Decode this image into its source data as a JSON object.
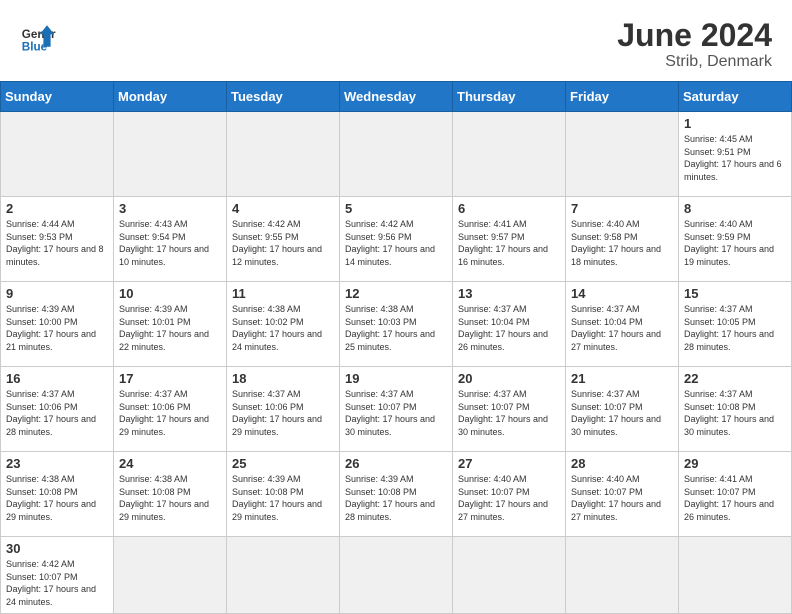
{
  "header": {
    "logo_general": "General",
    "logo_blue": "Blue",
    "month_year": "June 2024",
    "location": "Strib, Denmark"
  },
  "days_of_week": [
    "Sunday",
    "Monday",
    "Tuesday",
    "Wednesday",
    "Thursday",
    "Friday",
    "Saturday"
  ],
  "weeks": [
    [
      {
        "day": "",
        "empty": true
      },
      {
        "day": "",
        "empty": true
      },
      {
        "day": "",
        "empty": true
      },
      {
        "day": "",
        "empty": true
      },
      {
        "day": "",
        "empty": true
      },
      {
        "day": "",
        "empty": true
      },
      {
        "day": "1",
        "sunrise": "Sunrise: 4:45 AM",
        "sunset": "Sunset: 9:51 PM",
        "daylight": "Daylight: 17 hours and 6 minutes."
      }
    ],
    [
      {
        "day": "2",
        "sunrise": "Sunrise: 4:44 AM",
        "sunset": "Sunset: 9:53 PM",
        "daylight": "Daylight: 17 hours and 8 minutes."
      },
      {
        "day": "3",
        "sunrise": "Sunrise: 4:43 AM",
        "sunset": "Sunset: 9:54 PM",
        "daylight": "Daylight: 17 hours and 10 minutes."
      },
      {
        "day": "4",
        "sunrise": "Sunrise: 4:42 AM",
        "sunset": "Sunset: 9:55 PM",
        "daylight": "Daylight: 17 hours and 12 minutes."
      },
      {
        "day": "5",
        "sunrise": "Sunrise: 4:42 AM",
        "sunset": "Sunset: 9:56 PM",
        "daylight": "Daylight: 17 hours and 14 minutes."
      },
      {
        "day": "6",
        "sunrise": "Sunrise: 4:41 AM",
        "sunset": "Sunset: 9:57 PM",
        "daylight": "Daylight: 17 hours and 16 minutes."
      },
      {
        "day": "7",
        "sunrise": "Sunrise: 4:40 AM",
        "sunset": "Sunset: 9:58 PM",
        "daylight": "Daylight: 17 hours and 18 minutes."
      },
      {
        "day": "8",
        "sunrise": "Sunrise: 4:40 AM",
        "sunset": "Sunset: 9:59 PM",
        "daylight": "Daylight: 17 hours and 19 minutes."
      }
    ],
    [
      {
        "day": "9",
        "sunrise": "Sunrise: 4:39 AM",
        "sunset": "Sunset: 10:00 PM",
        "daylight": "Daylight: 17 hours and 21 minutes."
      },
      {
        "day": "10",
        "sunrise": "Sunrise: 4:39 AM",
        "sunset": "Sunset: 10:01 PM",
        "daylight": "Daylight: 17 hours and 22 minutes."
      },
      {
        "day": "11",
        "sunrise": "Sunrise: 4:38 AM",
        "sunset": "Sunset: 10:02 PM",
        "daylight": "Daylight: 17 hours and 24 minutes."
      },
      {
        "day": "12",
        "sunrise": "Sunrise: 4:38 AM",
        "sunset": "Sunset: 10:03 PM",
        "daylight": "Daylight: 17 hours and 25 minutes."
      },
      {
        "day": "13",
        "sunrise": "Sunrise: 4:37 AM",
        "sunset": "Sunset: 10:04 PM",
        "daylight": "Daylight: 17 hours and 26 minutes."
      },
      {
        "day": "14",
        "sunrise": "Sunrise: 4:37 AM",
        "sunset": "Sunset: 10:04 PM",
        "daylight": "Daylight: 17 hours and 27 minutes."
      },
      {
        "day": "15",
        "sunrise": "Sunrise: 4:37 AM",
        "sunset": "Sunset: 10:05 PM",
        "daylight": "Daylight: 17 hours and 28 minutes."
      }
    ],
    [
      {
        "day": "16",
        "sunrise": "Sunrise: 4:37 AM",
        "sunset": "Sunset: 10:06 PM",
        "daylight": "Daylight: 17 hours and 28 minutes."
      },
      {
        "day": "17",
        "sunrise": "Sunrise: 4:37 AM",
        "sunset": "Sunset: 10:06 PM",
        "daylight": "Daylight: 17 hours and 29 minutes."
      },
      {
        "day": "18",
        "sunrise": "Sunrise: 4:37 AM",
        "sunset": "Sunset: 10:06 PM",
        "daylight": "Daylight: 17 hours and 29 minutes."
      },
      {
        "day": "19",
        "sunrise": "Sunrise: 4:37 AM",
        "sunset": "Sunset: 10:07 PM",
        "daylight": "Daylight: 17 hours and 30 minutes."
      },
      {
        "day": "20",
        "sunrise": "Sunrise: 4:37 AM",
        "sunset": "Sunset: 10:07 PM",
        "daylight": "Daylight: 17 hours and 30 minutes."
      },
      {
        "day": "21",
        "sunrise": "Sunrise: 4:37 AM",
        "sunset": "Sunset: 10:07 PM",
        "daylight": "Daylight: 17 hours and 30 minutes."
      },
      {
        "day": "22",
        "sunrise": "Sunrise: 4:37 AM",
        "sunset": "Sunset: 10:08 PM",
        "daylight": "Daylight: 17 hours and 30 minutes."
      }
    ],
    [
      {
        "day": "23",
        "sunrise": "Sunrise: 4:38 AM",
        "sunset": "Sunset: 10:08 PM",
        "daylight": "Daylight: 17 hours and 29 minutes."
      },
      {
        "day": "24",
        "sunrise": "Sunrise: 4:38 AM",
        "sunset": "Sunset: 10:08 PM",
        "daylight": "Daylight: 17 hours and 29 minutes."
      },
      {
        "day": "25",
        "sunrise": "Sunrise: 4:39 AM",
        "sunset": "Sunset: 10:08 PM",
        "daylight": "Daylight: 17 hours and 29 minutes."
      },
      {
        "day": "26",
        "sunrise": "Sunrise: 4:39 AM",
        "sunset": "Sunset: 10:08 PM",
        "daylight": "Daylight: 17 hours and 28 minutes."
      },
      {
        "day": "27",
        "sunrise": "Sunrise: 4:40 AM",
        "sunset": "Sunset: 10:07 PM",
        "daylight": "Daylight: 17 hours and 27 minutes."
      },
      {
        "day": "28",
        "sunrise": "Sunrise: 4:40 AM",
        "sunset": "Sunset: 10:07 PM",
        "daylight": "Daylight: 17 hours and 27 minutes."
      },
      {
        "day": "29",
        "sunrise": "Sunrise: 4:41 AM",
        "sunset": "Sunset: 10:07 PM",
        "daylight": "Daylight: 17 hours and 26 minutes."
      }
    ],
    [
      {
        "day": "30",
        "sunrise": "Sunrise: 4:42 AM",
        "sunset": "Sunset: 10:07 PM",
        "daylight": "Daylight: 17 hours and 24 minutes."
      },
      {
        "day": "",
        "empty": true
      },
      {
        "day": "",
        "empty": true
      },
      {
        "day": "",
        "empty": true
      },
      {
        "day": "",
        "empty": true
      },
      {
        "day": "",
        "empty": true
      },
      {
        "day": "",
        "empty": true
      }
    ]
  ]
}
